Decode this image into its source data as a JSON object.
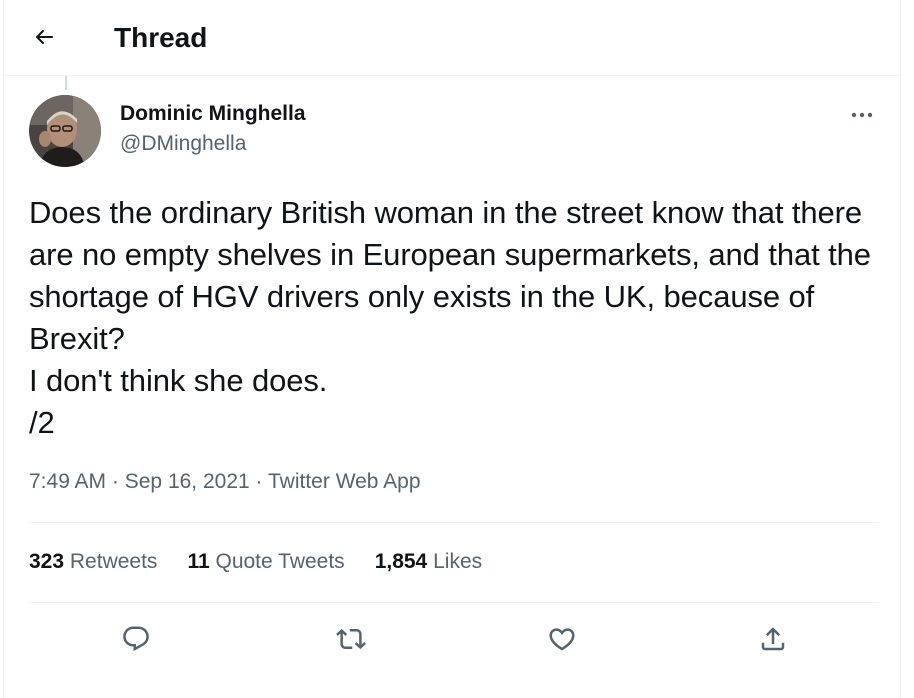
{
  "header": {
    "title": "Thread",
    "back_icon": "arrow-left-icon"
  },
  "author": {
    "name": "Dominic Minghella",
    "handle": "@DMinghella"
  },
  "tweet": {
    "text": "Does the ordinary British woman in the street know that there are no empty shelves in European supermarkets, and that the shortage of HGV drivers only exists in the UK, because of Brexit?\nI don't think she does.\n/2",
    "time": "7:49 AM",
    "date": "Sep 16, 2021",
    "source": "Twitter Web App",
    "separator": "·"
  },
  "stats": {
    "retweets_count": "323",
    "retweets_label": "Retweets",
    "quotes_count": "11",
    "quotes_label": "Quote Tweets",
    "likes_count": "1,854",
    "likes_label": "Likes"
  },
  "actions": {
    "reply_icon": "reply-icon",
    "retweet_icon": "retweet-icon",
    "like_icon": "heart-icon",
    "share_icon": "share-icon"
  },
  "colors": {
    "text_primary": "#0f1419",
    "text_secondary": "#536471",
    "divider": "#eff3f4"
  }
}
